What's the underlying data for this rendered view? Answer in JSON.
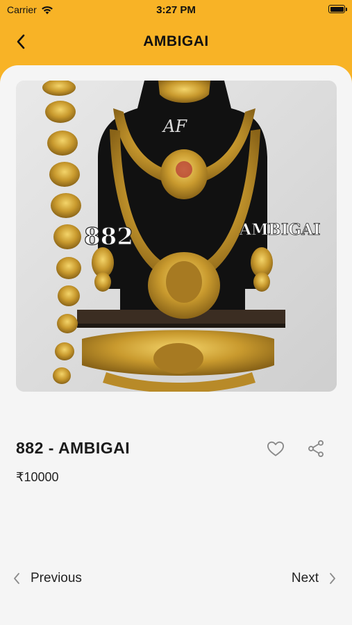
{
  "status_bar": {
    "carrier": "Carrier",
    "time": "3:27 PM"
  },
  "nav": {
    "title": "AMBIGAI",
    "back_icon": "chevron-left-icon"
  },
  "product": {
    "image_overlay_number": "882",
    "image_overlay_name": "AMBIGAI",
    "title": "882 - AMBIGAI",
    "price": "₹10000"
  },
  "actions": {
    "favorite_icon": "heart-outline-icon",
    "share_icon": "share-icon"
  },
  "pagination": {
    "previous_label": "Previous",
    "next_label": "Next"
  },
  "colors": {
    "accent": "#f8b326",
    "background": "#f5f5f5",
    "text": "#1b1b1b",
    "icon_gray": "#888888"
  }
}
